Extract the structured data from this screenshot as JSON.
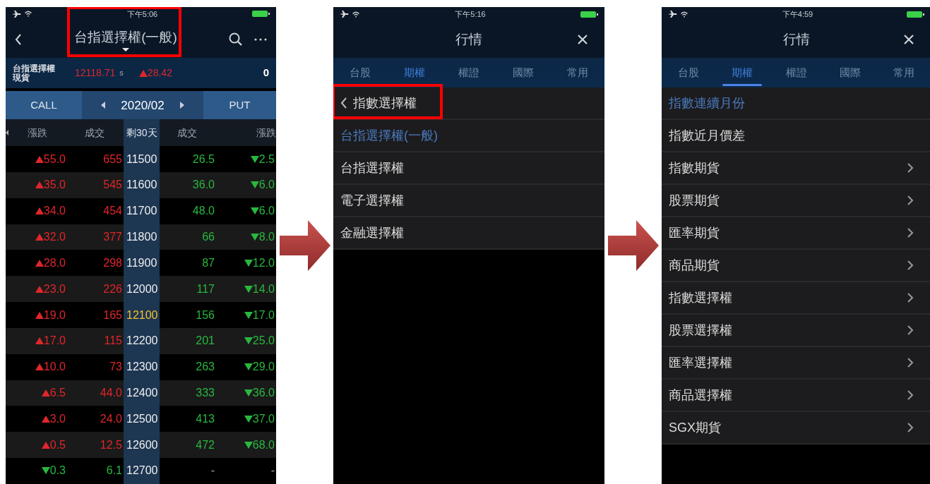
{
  "screens": [
    {
      "kind": "chain",
      "status_bar": {
        "time": "下午5:06"
      },
      "header": {
        "title": "台指選擇權(一般)",
        "highlighted": true
      },
      "quote": {
        "name": "台指選擇權",
        "type": "現貨",
        "price": "12118.71",
        "price_suffix": "s",
        "change": "28.42",
        "change_up": true,
        "volume": "0"
      },
      "expiry_bar": {
        "call": "CALL",
        "month": "2020/02",
        "put": "PUT"
      },
      "columns": [
        "漲跌",
        "成交",
        "剩30天",
        "成交",
        "漲跌"
      ],
      "rows": [
        {
          "call_change": "55.0",
          "call_volume": "655",
          "strike": "11500",
          "put_volume": "26.5",
          "put_change": "2.5",
          "call_up": true,
          "put_down": true,
          "at_the_money": false
        },
        {
          "call_change": "35.0",
          "call_volume": "545",
          "strike": "11600",
          "put_volume": "36.0",
          "put_change": "6.0",
          "call_up": true,
          "put_down": true,
          "at_the_money": false
        },
        {
          "call_change": "34.0",
          "call_volume": "454",
          "strike": "11700",
          "put_volume": "48.0",
          "put_change": "6.0",
          "call_up": true,
          "put_down": true,
          "at_the_money": false
        },
        {
          "call_change": "32.0",
          "call_volume": "377",
          "strike": "11800",
          "put_volume": "66",
          "put_change": "8.0",
          "call_up": true,
          "put_down": true,
          "at_the_money": false
        },
        {
          "call_change": "28.0",
          "call_volume": "298",
          "strike": "11900",
          "put_volume": "87",
          "put_change": "12.0",
          "call_up": true,
          "put_down": true,
          "at_the_money": false
        },
        {
          "call_change": "23.0",
          "call_volume": "226",
          "strike": "12000",
          "put_volume": "117",
          "put_change": "14.0",
          "call_up": true,
          "put_down": true,
          "at_the_money": false
        },
        {
          "call_change": "19.0",
          "call_volume": "165",
          "strike": "12100",
          "put_volume": "156",
          "put_change": "17.0",
          "call_up": true,
          "put_down": true,
          "at_the_money": true
        },
        {
          "call_change": "17.0",
          "call_volume": "115",
          "strike": "12200",
          "put_volume": "201",
          "put_change": "25.0",
          "call_up": true,
          "put_down": true,
          "at_the_money": false
        },
        {
          "call_change": "10.0",
          "call_volume": "73",
          "strike": "12300",
          "put_volume": "263",
          "put_change": "29.0",
          "call_up": true,
          "put_down": true,
          "at_the_money": false
        },
        {
          "call_change": "6.5",
          "call_volume": "44.0",
          "strike": "12400",
          "put_volume": "333",
          "put_change": "36.0",
          "call_up": true,
          "put_down": true,
          "at_the_money": false
        },
        {
          "call_change": "3.0",
          "call_volume": "24.0",
          "strike": "12500",
          "put_volume": "413",
          "put_change": "37.0",
          "call_up": true,
          "put_down": true,
          "at_the_money": false
        },
        {
          "call_change": "0.5",
          "call_volume": "12.5",
          "strike": "12600",
          "put_volume": "472",
          "put_change": "68.0",
          "call_up": true,
          "put_down": true,
          "at_the_money": false
        },
        {
          "call_change": "0.3",
          "call_volume": "6.1",
          "strike": "12700",
          "put_volume": "-",
          "put_change": "-",
          "call_up": false,
          "put_down": false,
          "at_the_money": false
        }
      ]
    },
    {
      "kind": "menu",
      "status_bar": {
        "time": "下午5:16"
      },
      "header": {
        "title": "行情"
      },
      "tabs": [
        {
          "label": "台股",
          "selected": false
        },
        {
          "label": "期權",
          "selected": true
        },
        {
          "label": "權證",
          "selected": false
        },
        {
          "label": "國際",
          "selected": false
        },
        {
          "label": "常用",
          "selected": false
        }
      ],
      "tab_underline": false,
      "back": {
        "label": "指數選擇權",
        "highlighted": true
      },
      "items": [
        {
          "label": "台指選擇權(一般)",
          "selected": true,
          "has_chevron": false
        },
        {
          "label": "台指選擇權",
          "selected": false,
          "has_chevron": false
        },
        {
          "label": "電子選擇權",
          "selected": false,
          "has_chevron": false
        },
        {
          "label": "金融選擇權",
          "selected": false,
          "has_chevron": false
        }
      ]
    },
    {
      "kind": "menu",
      "status_bar": {
        "time": "下午4:59"
      },
      "header": {
        "title": "行情"
      },
      "tabs": [
        {
          "label": "台股",
          "selected": false
        },
        {
          "label": "期權",
          "selected": true
        },
        {
          "label": "權證",
          "selected": false
        },
        {
          "label": "國際",
          "selected": false
        },
        {
          "label": "常用",
          "selected": false
        }
      ],
      "tab_underline": true,
      "items": [
        {
          "label": "指數連續月份",
          "selected": true,
          "has_chevron": false
        },
        {
          "label": "指數近月價差",
          "selected": false,
          "has_chevron": false
        },
        {
          "label": "指數期貨",
          "selected": false,
          "has_chevron": true
        },
        {
          "label": "股票期貨",
          "selected": false,
          "has_chevron": true
        },
        {
          "label": "匯率期貨",
          "selected": false,
          "has_chevron": true
        },
        {
          "label": "商品期貨",
          "selected": false,
          "has_chevron": true
        },
        {
          "label": "指數選擇權",
          "selected": false,
          "has_chevron": true
        },
        {
          "label": "股票選擇權",
          "selected": false,
          "has_chevron": true
        },
        {
          "label": "匯率選擇權",
          "selected": false,
          "has_chevron": true
        },
        {
          "label": "商品選擇權",
          "selected": false,
          "has_chevron": true
        },
        {
          "label": "SGX期貨",
          "selected": false,
          "has_chevron": true
        }
      ]
    }
  ]
}
